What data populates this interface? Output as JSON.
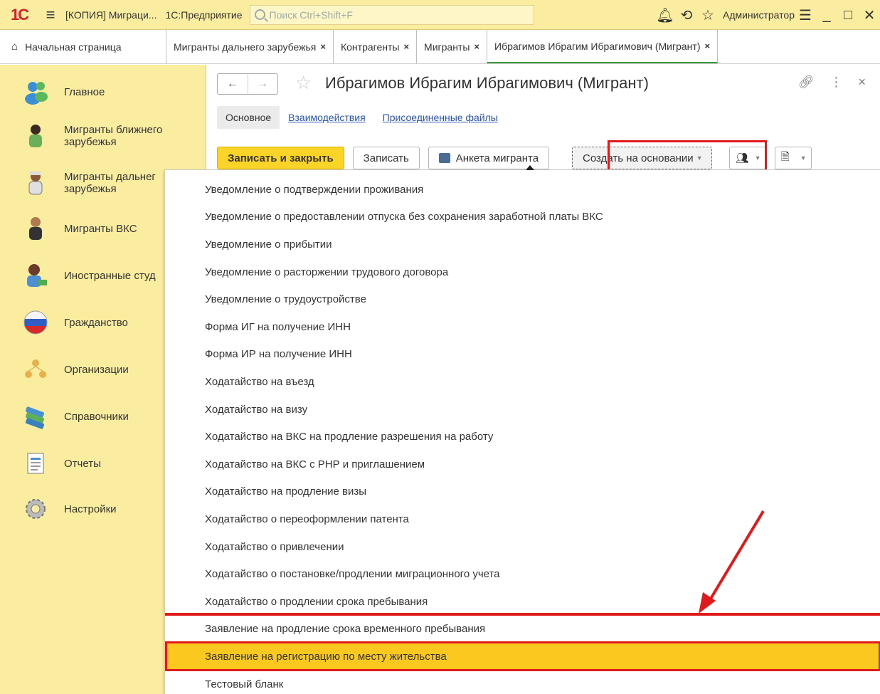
{
  "titlebar": {
    "logo": "1С",
    "hamburger_icon": "hamburger-icon",
    "doc_title": "[КОПИЯ] Миграци...",
    "app_name": "1С:Предприятие",
    "search_placeholder": "Поиск Ctrl+Shift+F",
    "user": "Администратор"
  },
  "tabs": [
    {
      "label": "Начальная страница",
      "closable": false
    },
    {
      "label": "Мигранты дальнего зарубежья",
      "closable": true
    },
    {
      "label": "Контрагенты",
      "closable": true
    },
    {
      "label": "Мигранты",
      "closable": true
    },
    {
      "label": "Ибрагимов Ибрагим Ибрагимович (Мигрант)",
      "closable": true,
      "active": true
    }
  ],
  "tab_close": "×",
  "sidebar": {
    "items": [
      {
        "label": "Главное",
        "icon": "people-icon"
      },
      {
        "label": "Мигранты ближнего\nзарубежья",
        "icon": "migrant-near-icon"
      },
      {
        "label": "Мигранты дальнег\nзарубежья",
        "icon": "migrant-far-icon"
      },
      {
        "label": "Мигранты ВКС",
        "icon": "migrant-hqs-icon"
      },
      {
        "label": "Иностранные студ",
        "icon": "student-icon"
      },
      {
        "label": "Гражданство",
        "icon": "flag-icon"
      },
      {
        "label": "Организации",
        "icon": "organization-icon"
      },
      {
        "label": "Справочники",
        "icon": "books-icon"
      },
      {
        "label": "Отчеты",
        "icon": "report-icon"
      },
      {
        "label": "Настройки",
        "icon": "settings-icon"
      }
    ]
  },
  "form": {
    "title": "Ибрагимов Ибрагим Ибрагимович (Мигрант)",
    "tabs": [
      {
        "label": "Основное",
        "active": true
      },
      {
        "label": "Взаимодействия",
        "active": false
      },
      {
        "label": "Присоединенные файлы",
        "active": false
      }
    ],
    "buttons": {
      "save_close": "Записать и закрыть",
      "save": "Записать",
      "questionnaire": "Анкета мигранта",
      "create_based": "Создать на основании"
    }
  },
  "dropdown": {
    "items": [
      "Уведомление о подтверждении проживания",
      "Уведомление о предоставлении отпуска без сохранения заработной платы ВКС",
      "Уведомление о прибытии",
      "Уведомление о расторжении трудового договора",
      "Уведомление о трудоустройстве",
      "Форма ИГ на получение ИНН",
      "Форма ИР на получение ИНН",
      "Ходатайство на въезд",
      "Ходатайство на визу",
      "Ходатайство на ВКС на продление разрешения на работу",
      "Ходатайство на ВКС с РНР и приглашением",
      "Ходатайство на продление визы",
      "Ходатайство о переоформлении патента",
      "Ходатайство о привлечении",
      "Ходатайство о постановке/продлении миграционного учета",
      "Ходатайство о продлении срока пребывания",
      "Заявление на продление срока временного пребывания",
      "Заявление на регистрацию по месту жительства",
      "Тестовый бланк"
    ],
    "selected_index": 17
  },
  "colors": {
    "sidebar_bg": "#fbeda0",
    "accent_yellow": "#fcd427",
    "selected_row": "#fbc81f",
    "annotation_red": "#e0191b",
    "link_blue": "#2a55b2"
  }
}
